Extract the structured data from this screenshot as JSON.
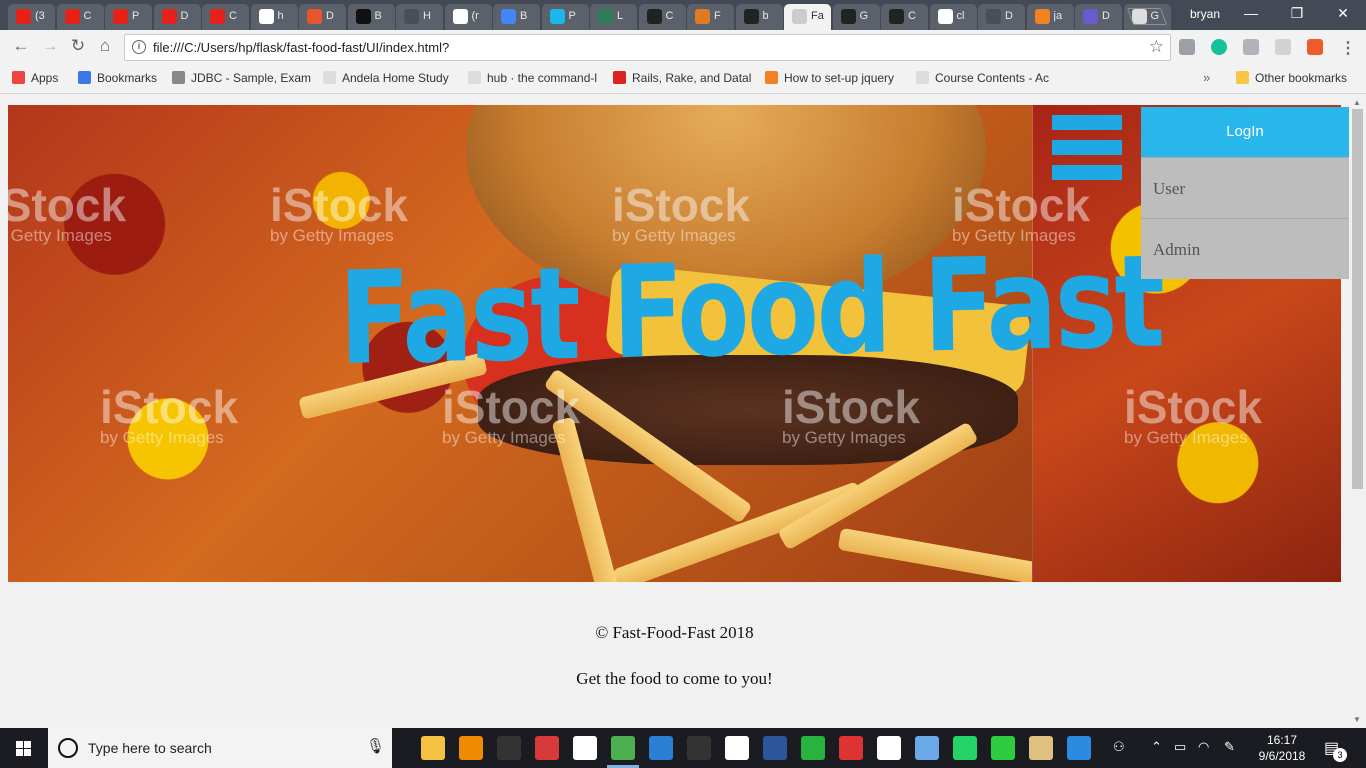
{
  "browser": {
    "tabs": [
      {
        "title": "(3",
        "icon": "youtube-icon",
        "color": "#e62117"
      },
      {
        "title": "C",
        "icon": "youtube-icon",
        "color": "#e62117"
      },
      {
        "title": "P",
        "icon": "youtube-icon",
        "color": "#e62117"
      },
      {
        "title": "D",
        "icon": "youtube-icon",
        "color": "#e62117"
      },
      {
        "title": "C",
        "icon": "youtube-icon",
        "color": "#e62117"
      },
      {
        "title": "h",
        "icon": "google-icon",
        "color": "#ffffff"
      },
      {
        "title": "D",
        "icon": "shield-icon",
        "color": "#e8552c"
      },
      {
        "title": "B",
        "icon": "medium-icon",
        "color": "#111111"
      },
      {
        "title": "H",
        "icon": "page-icon",
        "color": "#4a4f57"
      },
      {
        "title": "(r",
        "icon": "gmail-icon",
        "color": "#ffffff"
      },
      {
        "title": "B",
        "icon": "docs-icon",
        "color": "#4285f4"
      },
      {
        "title": "P",
        "icon": "vimeo-icon",
        "color": "#1ab7ea"
      },
      {
        "title": "L",
        "icon": "pivotal-icon",
        "color": "#2e7d55"
      },
      {
        "title": "C",
        "icon": "github-icon",
        "color": "#222222"
      },
      {
        "title": "F",
        "icon": "gear-icon",
        "color": "#e07b22"
      },
      {
        "title": "b",
        "icon": "github-icon",
        "color": "#222222"
      },
      {
        "title": "Fa",
        "icon": "page-icon",
        "color": "#cccccc",
        "active": true
      },
      {
        "title": "G",
        "icon": "github-icon",
        "color": "#222222"
      },
      {
        "title": "C",
        "icon": "github-icon",
        "color": "#222222"
      },
      {
        "title": "cl",
        "icon": "google-icon",
        "color": "#ffffff"
      },
      {
        "title": "D",
        "icon": "page-icon",
        "color": "#4a4f57"
      },
      {
        "title": "ja",
        "icon": "stackoverflow-icon",
        "color": "#f48024"
      },
      {
        "title": "D",
        "icon": "circle-icon",
        "color": "#6a5acd"
      },
      {
        "title": "G",
        "icon": "square-icon",
        "color": "#dddddd"
      }
    ],
    "profile_name": "bryan",
    "window_controls": {
      "minimize": "—",
      "restore": "❐",
      "close": "✕"
    },
    "address_url": "file:///C:/Users/hp/flask/fast-food-fast/UI/index.html?",
    "bookmarks": [
      {
        "label": "Apps",
        "icon": "apps-icon",
        "color": "#e44"
      },
      {
        "label": "Bookmarks",
        "icon": "star-icon",
        "color": "#3b78e7"
      },
      {
        "label": "JDBC - Sample, Exam",
        "icon": "diamond-icon",
        "color": "#888"
      },
      {
        "label": "Andela Home Study",
        "icon": "page-icon",
        "color": "#ddd"
      },
      {
        "label": "hub · the command-l",
        "icon": "page-icon",
        "color": "#ddd"
      },
      {
        "label": "Rails, Rake, and Datal",
        "icon": "star-icon",
        "color": "#d22"
      },
      {
        "label": "How to set-up jquery",
        "icon": "stackoverflow-icon",
        "color": "#f48024"
      },
      {
        "label": "Course Contents - Ac",
        "icon": "page-icon",
        "color": "#ddd"
      },
      {
        "label": "Other bookmarks",
        "icon": "folder-icon",
        "color": "#f6c744"
      }
    ],
    "bookmarks_overflow": "»"
  },
  "page": {
    "hero": {
      "brand_title": "Fast Food Fast",
      "watermark_main": "iStock",
      "watermark_sub": "by Getty Images"
    },
    "menu": {
      "login_label": "LogIn",
      "items": [
        "User",
        "Admin"
      ]
    },
    "footer": {
      "copyright": "© Fast-Food-Fast 2018",
      "tagline": "Get the food to come to you!"
    },
    "colors": {
      "accent": "#29b6ea",
      "brand_text": "#1fa9e4",
      "menu_item_bg": "#bdbdbd"
    }
  },
  "taskbar": {
    "search_placeholder": "Type here to search",
    "time": "16:17",
    "date": "9/6/2018",
    "notification_count": "3",
    "apps": [
      {
        "icon": "file-explorer-icon",
        "color": "#f4c242"
      },
      {
        "icon": "vlc-icon",
        "color": "#f08a00"
      },
      {
        "icon": "terminal-icon",
        "color": "#333333"
      },
      {
        "icon": "app-icon",
        "color": "#d63a3a"
      },
      {
        "icon": "sticky-notes-icon",
        "color": "#ffffff"
      },
      {
        "icon": "chrome-icon",
        "color": "#4caf50",
        "active": true
      },
      {
        "icon": "vscode-icon",
        "color": "#2a7fd4"
      },
      {
        "icon": "terminal-icon",
        "color": "#333333"
      },
      {
        "icon": "slack-icon",
        "color": "#ffffff"
      },
      {
        "icon": "word-icon",
        "color": "#2b579a"
      },
      {
        "icon": "refresh-icon",
        "color": "#27b33e"
      },
      {
        "icon": "app-icon",
        "color": "#d33"
      },
      {
        "icon": "emoji-icon",
        "color": "#ffffff"
      },
      {
        "icon": "display-icon",
        "color": "#6aa8e8"
      },
      {
        "icon": "whatsapp-icon",
        "color": "#25d366"
      },
      {
        "icon": "git-icon",
        "color": "#2ecc40"
      },
      {
        "icon": "paint-icon",
        "color": "#e0c080"
      },
      {
        "icon": "help-icon",
        "color": "#2a8be0"
      }
    ]
  }
}
